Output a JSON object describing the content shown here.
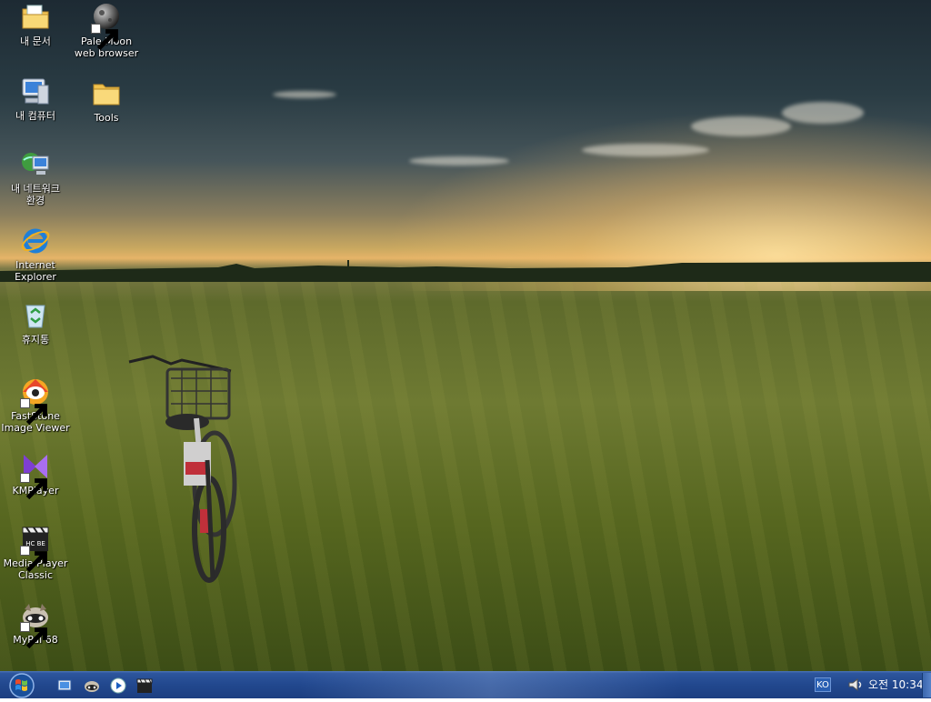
{
  "desktop_icons": [
    {
      "id": "my-documents",
      "label": "내 문서",
      "shortcut": false,
      "icon": "folder-documents-icon"
    },
    {
      "id": "pale-moon",
      "label": "Pale Moon\nweb browser",
      "shortcut": true,
      "icon": "pale-moon-icon"
    },
    {
      "id": "my-computer",
      "label": "내 컴퓨터",
      "shortcut": false,
      "icon": "computer-icon"
    },
    {
      "id": "tools",
      "label": "Tools",
      "shortcut": false,
      "icon": "folder-icon"
    },
    {
      "id": "network",
      "label": "내 네트워크\n환경",
      "shortcut": false,
      "icon": "network-icon"
    },
    {
      "id": "ie",
      "label": "Internet\nExplorer",
      "shortcut": false,
      "icon": "internet-explorer-icon"
    },
    {
      "id": "recycle-bin",
      "label": "휴지통",
      "shortcut": false,
      "icon": "recycle-bin-icon"
    },
    {
      "id": "faststone",
      "label": "FastStone\nImage Viewer",
      "shortcut": true,
      "icon": "faststone-icon"
    },
    {
      "id": "kmplayer",
      "label": "KMPlayer",
      "shortcut": true,
      "icon": "kmplayer-icon"
    },
    {
      "id": "mpc",
      "label": "Media Player\nClassic",
      "shortcut": true,
      "icon": "media-player-classic-icon"
    },
    {
      "id": "mypal",
      "label": "MyPal 68",
      "shortcut": true,
      "icon": "mypal-icon"
    }
  ],
  "taskbar": {
    "start_icon": "windows-start-orb-icon",
    "quick_launch": [
      "show-desktop-icon",
      "mypal-icon",
      "media-player-icon",
      "media-player-classic-icon"
    ],
    "language_indicator": "KO",
    "volume_icon": "volume-icon",
    "clock": "오전 10:34"
  },
  "colors": {
    "taskbar": "#22488e",
    "sky_dark": "#1d2a33",
    "sunset": "#e6b468",
    "grass": "#5e6a2c"
  }
}
